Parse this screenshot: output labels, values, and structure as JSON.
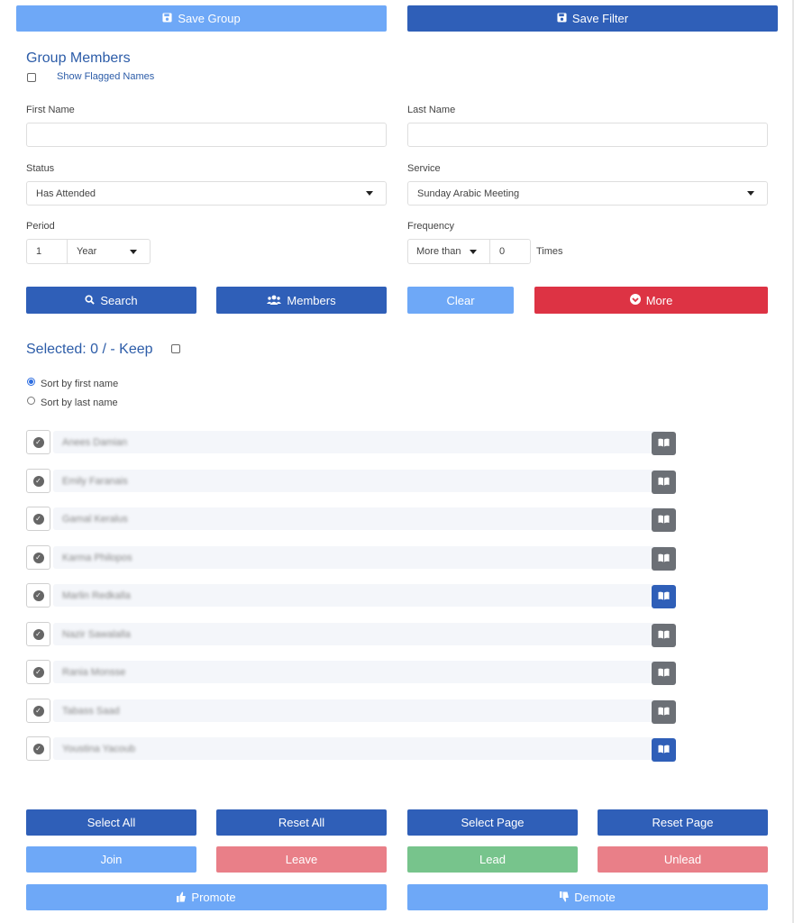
{
  "toolbar": {
    "save_group": "Save Group",
    "save_filter": "Save Filter"
  },
  "filter": {
    "title": "Group Members",
    "show_flagged": "Show Flagged Names",
    "first_name_label": "First Name",
    "first_name_value": "",
    "last_name_label": "Last Name",
    "last_name_value": "",
    "status_label": "Status",
    "status_value": "Has Attended",
    "service_label": "Service",
    "service_value": "Sunday Arabic Meeting",
    "period_label": "Period",
    "period_number": "1",
    "period_unit": "Year",
    "frequency_label": "Frequency",
    "frequency_op": "More than",
    "frequency_count": "0",
    "frequency_unit": "Times"
  },
  "actions": {
    "search": "Search",
    "members": "Members",
    "clear": "Clear",
    "more": "More"
  },
  "selection": {
    "summary": "Selected: 0 / - Keep",
    "sort_first": "Sort by first name",
    "sort_last": "Sort by last name"
  },
  "members": [
    {
      "name": "Anees Damian",
      "book": "gray"
    },
    {
      "name": "Emily Faranais",
      "book": "gray"
    },
    {
      "name": "Gamal Keralus",
      "book": "gray"
    },
    {
      "name": "Karma Philopos",
      "book": "gray"
    },
    {
      "name": "Marlin Redkalla",
      "book": "blue"
    },
    {
      "name": "Nazir Sawalalla",
      "book": "gray"
    },
    {
      "name": "Rania Monsse",
      "book": "gray"
    },
    {
      "name": "Tabass Saad",
      "book": "gray"
    },
    {
      "name": "Youstina Yacoub",
      "book": "blue"
    }
  ],
  "bulk": {
    "select_all": "Select All",
    "reset_all": "Reset All",
    "select_page": "Select Page",
    "reset_page": "Reset Page",
    "join": "Join",
    "leave": "Leave",
    "lead": "Lead",
    "unlead": "Unlead",
    "promote": "Promote",
    "demote": "Demote"
  },
  "colors": {
    "primary": "#2f5fb8",
    "primary_light": "#6ea8f7",
    "danger": "#dd3344",
    "danger_light": "#e97f88",
    "success_light": "#77c48c",
    "title": "#2c5ca8"
  },
  "icons": {
    "save": "floppy-disk-icon",
    "search": "magnifier-icon",
    "members": "users-icon",
    "more": "chevron-circle-down-icon",
    "check": "check-circle-icon",
    "book": "open-book-icon",
    "promote": "thumbs-up-icon",
    "demote": "thumbs-down-icon"
  }
}
